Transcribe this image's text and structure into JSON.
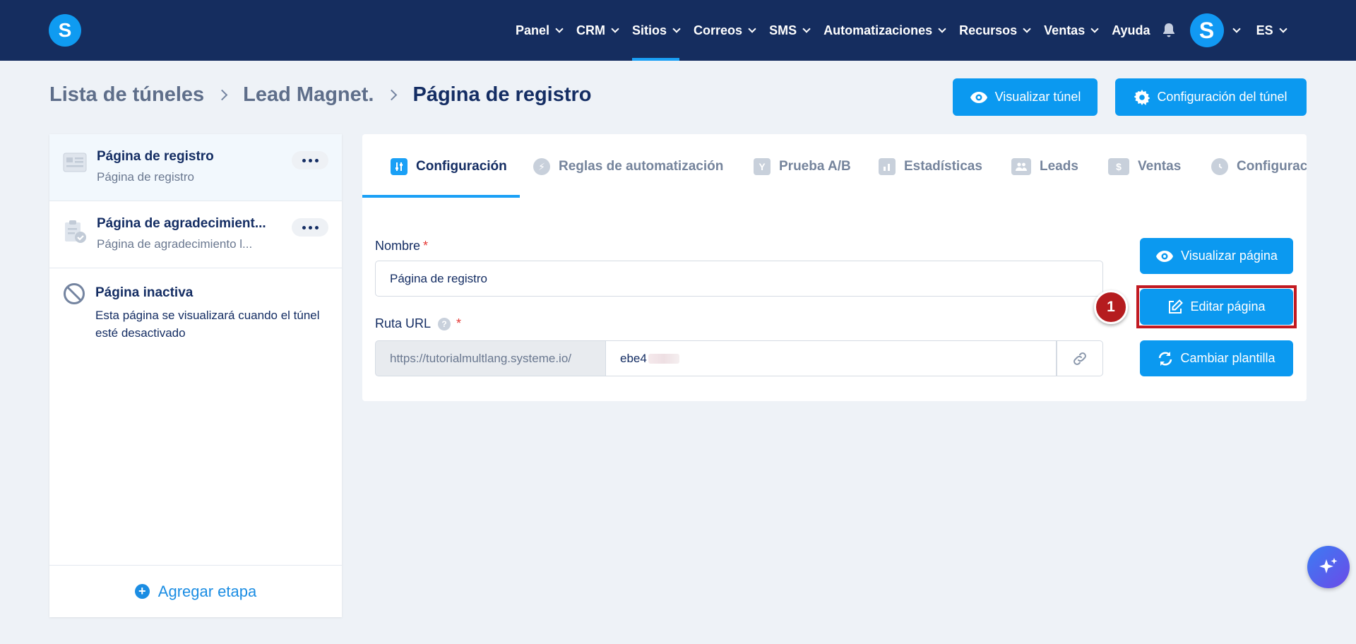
{
  "app": {
    "logo_letter": "S"
  },
  "nav": {
    "items": [
      {
        "label": "Panel",
        "has_menu": true
      },
      {
        "label": "CRM",
        "has_menu": true
      },
      {
        "label": "Sitios",
        "has_menu": true,
        "active": true
      },
      {
        "label": "Correos",
        "has_menu": true
      },
      {
        "label": "SMS",
        "has_menu": true
      },
      {
        "label": "Automatizaciones",
        "has_menu": true
      },
      {
        "label": "Recursos",
        "has_menu": true
      },
      {
        "label": "Ventas",
        "has_menu": true
      },
      {
        "label": "Ayuda",
        "has_menu": false
      }
    ],
    "avatar_letter": "S",
    "language": "ES",
    "icons": [
      "bell-icon",
      "chevron-down-icon"
    ]
  },
  "breadcrumb": {
    "items": [
      "Lista de túneles",
      "Lead Magnet.",
      "Página de registro"
    ]
  },
  "header_buttons": {
    "preview_funnel": "Visualizar túnel",
    "funnel_settings": "Configuración del túnel"
  },
  "sidebar": {
    "steps": [
      {
        "title": "Página de registro",
        "subtitle": "Página de registro",
        "selected": true
      },
      {
        "title": "Página de agradecimient...",
        "subtitle": "Página de agradecimiento l..."
      }
    ],
    "inactive": {
      "title": "Página inactiva",
      "description": "Esta página se visualizará cuando el túnel esté desactivado"
    },
    "add_step": "Agregar etapa"
  },
  "tabs": [
    {
      "label": "Configuración",
      "active": true
    },
    {
      "label": "Reglas de automatización"
    },
    {
      "label": "Prueba A/B"
    },
    {
      "label": "Estadísticas"
    },
    {
      "label": "Leads"
    },
    {
      "label": "Ventas"
    },
    {
      "label": "Configurac"
    }
  ],
  "form": {
    "name_label": "Nombre",
    "name_value": "Página de registro",
    "url_label": "Ruta URL",
    "url_help": "?",
    "url_prefix": "https://tutorialmultlang.systeme.io/",
    "url_slug": "ebe4",
    "required_mark": "*"
  },
  "actions": {
    "preview_page": "Visualizar página",
    "edit_page": "Editar página",
    "change_template": "Cambiar plantilla"
  },
  "annotation": {
    "marker_number": "1"
  },
  "colors": {
    "nav_bg": "#152d5f",
    "accent": "#0b99f0",
    "highlight": "#c21a22"
  }
}
